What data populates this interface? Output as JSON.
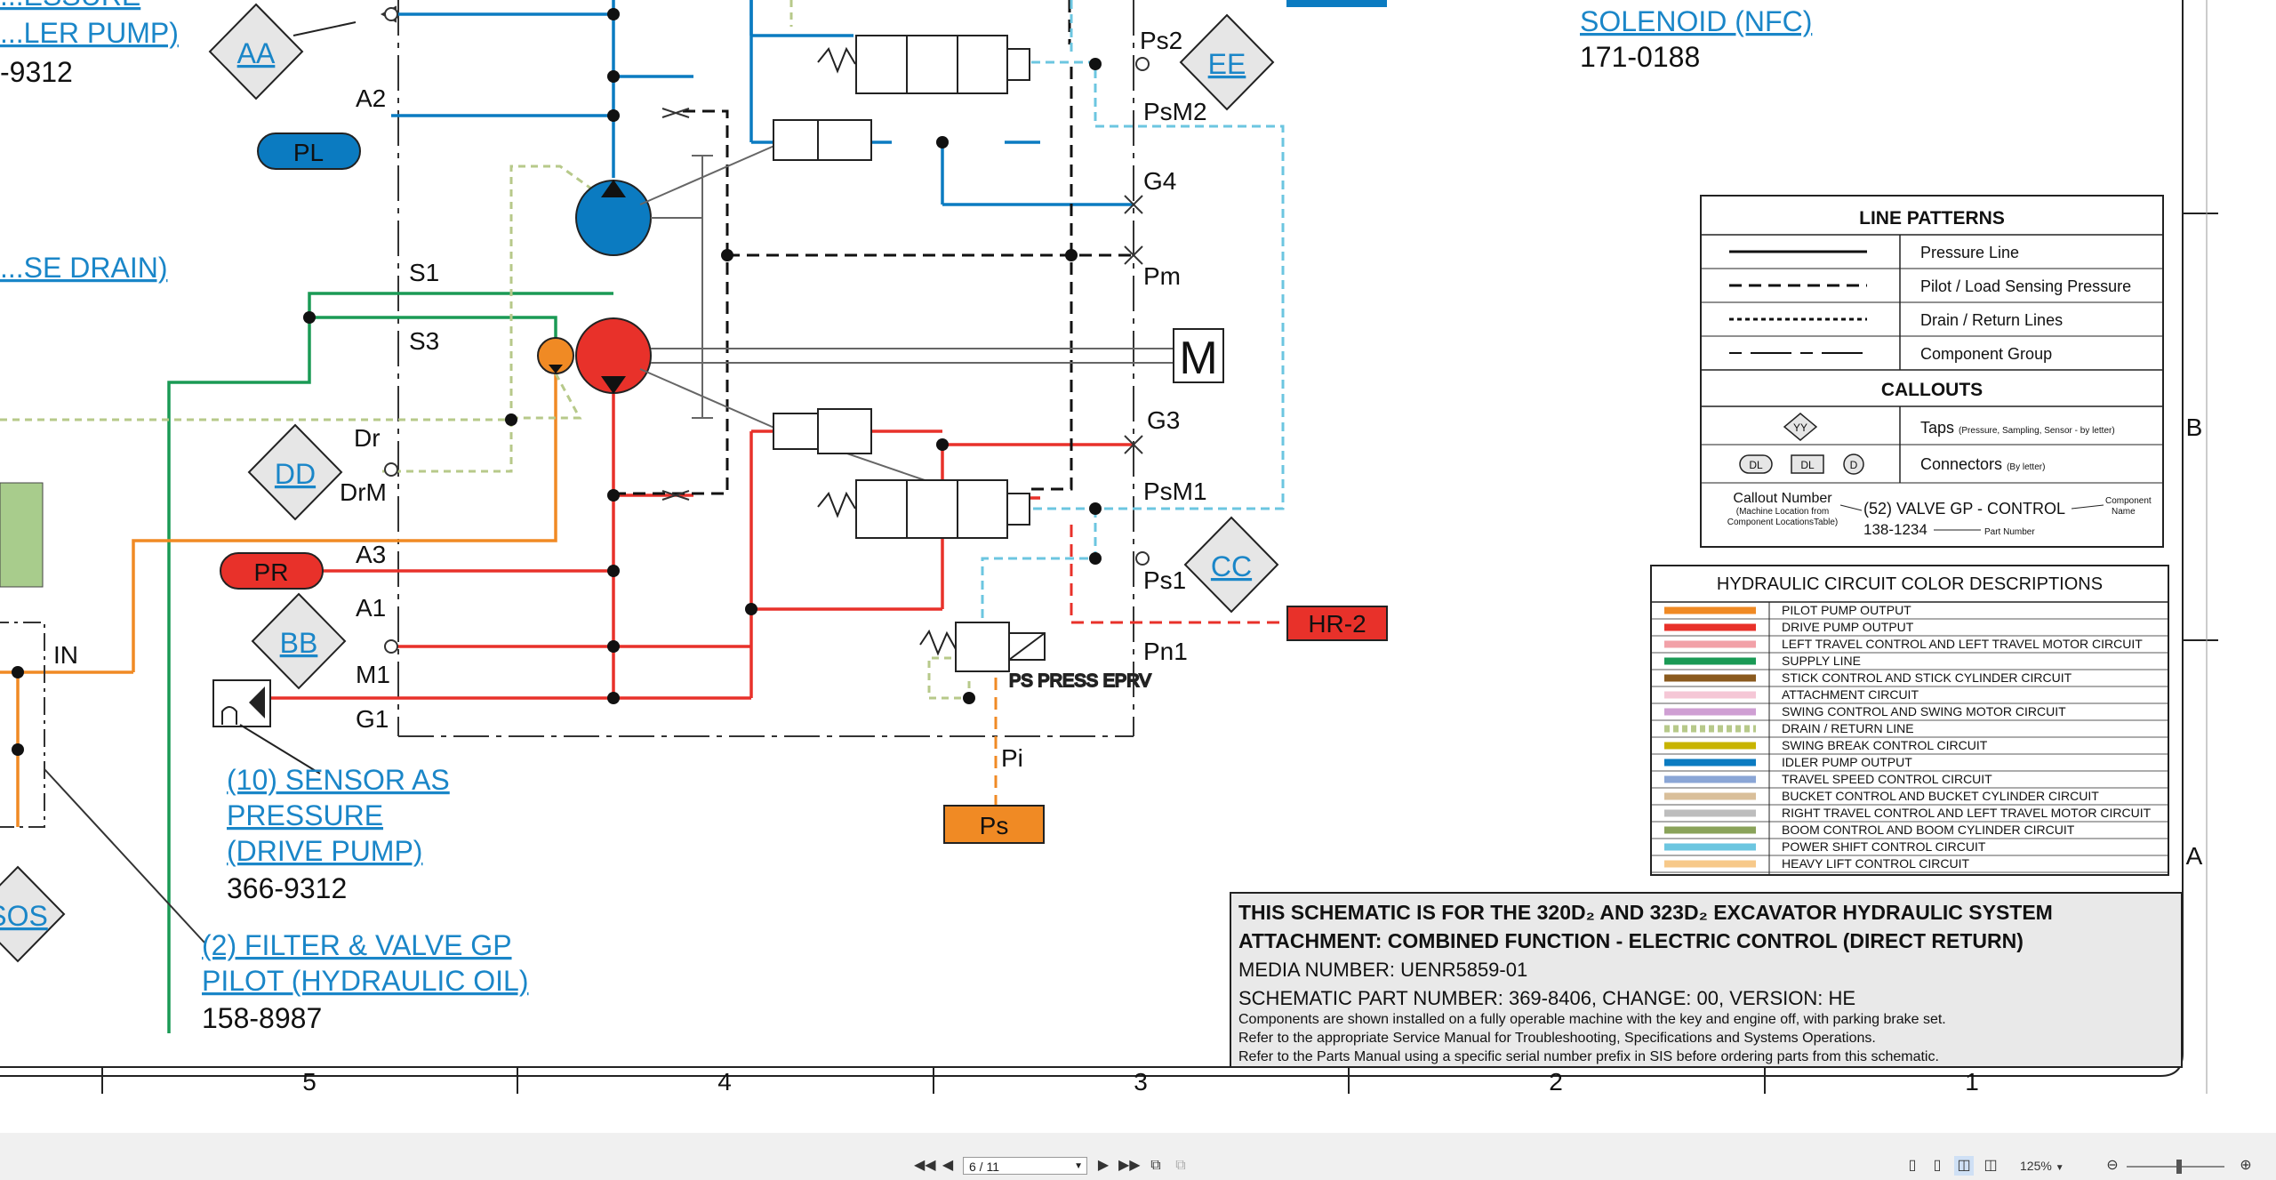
{
  "callouts": {
    "top_left_1": "...ESSURE",
    "top_left_2": "...LER PUMP)",
    "top_left_part": "-9312",
    "solenoid_title": "SOLENOID (NFC)",
    "solenoid_part": "171-0188",
    "drain_title": "...SE DRAIN)",
    "sensor_l1": "(10) SENSOR AS",
    "sensor_l2": "PRESSURE",
    "sensor_l3": "(DRIVE PUMP)",
    "sensor_part": "366-9312",
    "filter_l1": "(2) FILTER & VALVE GP",
    "filter_l2": "PILOT (HYDRAULIC OIL)",
    "filter_part": "158-8987"
  },
  "taps": [
    "AA",
    "EE",
    "DD",
    "BB",
    "CC",
    "SOS"
  ],
  "connectors": [
    "PL",
    "PR",
    "HR-2",
    "Ps"
  ],
  "port_labels": [
    "A2",
    "S1",
    "S3",
    "Dr",
    "DrM",
    "A3",
    "A1",
    "M1",
    "G1",
    "IN",
    "Ps2",
    "PsM2",
    "G4",
    "Pm",
    "G3",
    "PsM1",
    "Ps1",
    "Pn1",
    "Pi"
  ],
  "motor": "M",
  "eprv_label": "PS PRESS EPRV",
  "legend": {
    "title": "LINE PATTERNS",
    "patterns": [
      "Pressure Line",
      "Pilot / Load Sensing Pressure",
      "Drain / Return Lines",
      "Component Group"
    ],
    "callouts_title": "CALLOUTS",
    "taps_label": "Taps",
    "taps_note": "(Pressure, Sampling, Sensor - by letter)",
    "tap_sample": "YY",
    "connectors_label": "Connectors",
    "connectors_note": "(By letter)",
    "connector_samples": [
      "DL",
      "DL",
      "D"
    ],
    "callout_number": "Callout Number",
    "callout_number_note1": "(Machine Location from",
    "callout_number_note2": "Component LocationsTable)",
    "callout_example": "(52) VALVE GP - CONTROL",
    "component_name_1": "Component",
    "component_name_2": "Name",
    "callout_part": "138-1234",
    "part_number": "Part Number"
  },
  "color_table": {
    "title": "HYDRAULIC CIRCUIT COLOR DESCRIPTIONS",
    "rows": [
      {
        "color": "#f08a24",
        "label": "PILOT PUMP OUTPUT"
      },
      {
        "color": "#e8312a",
        "label": "DRIVE PUMP OUTPUT"
      },
      {
        "color": "#f2a1a8",
        "label": "LEFT TRAVEL CONTROL AND LEFT TRAVEL MOTOR CIRCUIT"
      },
      {
        "color": "#1a9a55",
        "label": "SUPPLY LINE"
      },
      {
        "color": "#8a5a1e",
        "label": "STICK CONTROL AND STICK CYLINDER CIRCUIT"
      },
      {
        "color": "#f5c7d6",
        "label": "ATTACHMENT CIRCUIT"
      },
      {
        "color": "#cf9fd3",
        "label": "SWING CONTROL AND SWING MOTOR CIRCUIT"
      },
      {
        "color": "#b7c98a",
        "label": "DRAIN / RETURN LINE",
        "dotted": true
      },
      {
        "color": "#c8b400",
        "label": "SWING BREAK CONTROL CIRCUIT"
      },
      {
        "color": "#0b7bc1",
        "label": "IDLER PUMP OUTPUT"
      },
      {
        "color": "#8aa6d6",
        "label": "TRAVEL SPEED CONTROL CIRCUIT"
      },
      {
        "color": "#d9bf9a",
        "label": "BUCKET CONTROL AND BUCKET CYLINDER CIRCUIT"
      },
      {
        "color": "#bdbdbd",
        "label": "RIGHT TRAVEL CONTROL AND LEFT TRAVEL MOTOR CIRCUIT"
      },
      {
        "color": "#8aa35a",
        "label": "BOOM CONTROL AND BOOM CYLINDER CIRCUIT"
      },
      {
        "color": "#6cc6e0",
        "label": "POWER SHIFT CONTROL CIRCUIT"
      },
      {
        "color": "#f7c98a",
        "label": "HEAVY LIFT CONTROL CIRCUIT"
      }
    ]
  },
  "title_block": {
    "line1": "THIS SCHEMATIC IS FOR THE 320D₂ AND 323D₂ EXCAVATOR HYDRAULIC SYSTEM",
    "line2": "ATTACHMENT: COMBINED FUNCTION - ELECTRIC CONTROL (DIRECT RETURN)",
    "line3": "MEDIA NUMBER: UENR5859-01",
    "line4": "SCHEMATIC PART NUMBER: 369-8406, CHANGE: 00, VERSION: HE",
    "note1": "Components are shown installed on a fully operable machine with the key and engine off, with parking brake set.",
    "note2": "Refer to the appropriate Service Manual for Troubleshooting, Specifications and Systems Operations.",
    "note3": "Refer to the Parts Manual using a specific serial number prefix in SIS before ordering parts from this schematic."
  },
  "grid_columns": [
    "5",
    "4",
    "3",
    "2",
    "1"
  ],
  "grid_rows": [
    "B",
    "A"
  ],
  "viewer": {
    "page": "6 / 11",
    "zoom": "125%"
  }
}
